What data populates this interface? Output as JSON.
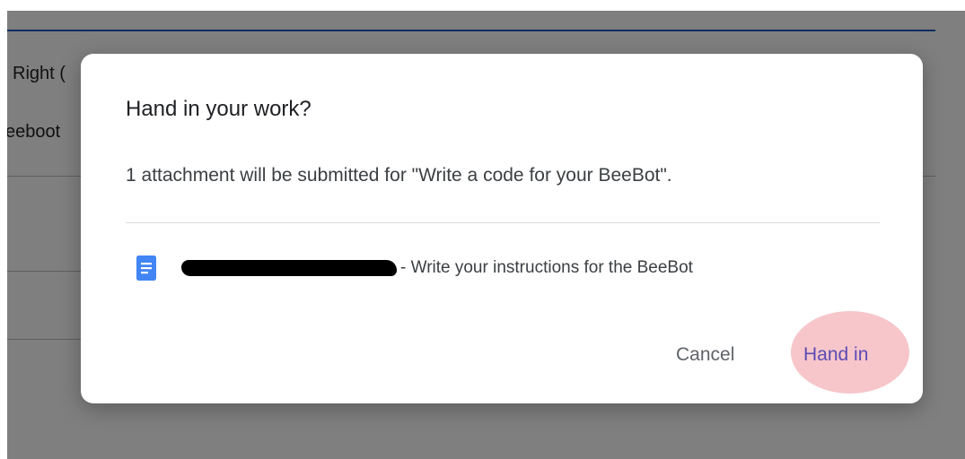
{
  "background": {
    "partial_label_1": "Right (",
    "partial_label_2": "eeboot"
  },
  "dialog": {
    "title": "Hand in your work?",
    "message": "1 attachment will be submitted for \"Write a code for your BeeBot\".",
    "attachment": {
      "icon": "google-docs-icon",
      "name": "- Write your instructions for the BeeBot",
      "name_redacted": true
    },
    "cancel_label": "Cancel",
    "handin_label": "Hand in"
  },
  "colors": {
    "accent": "#5b4bb3",
    "highlight": "#f6c6cb",
    "doc_icon": "#4285f4"
  }
}
